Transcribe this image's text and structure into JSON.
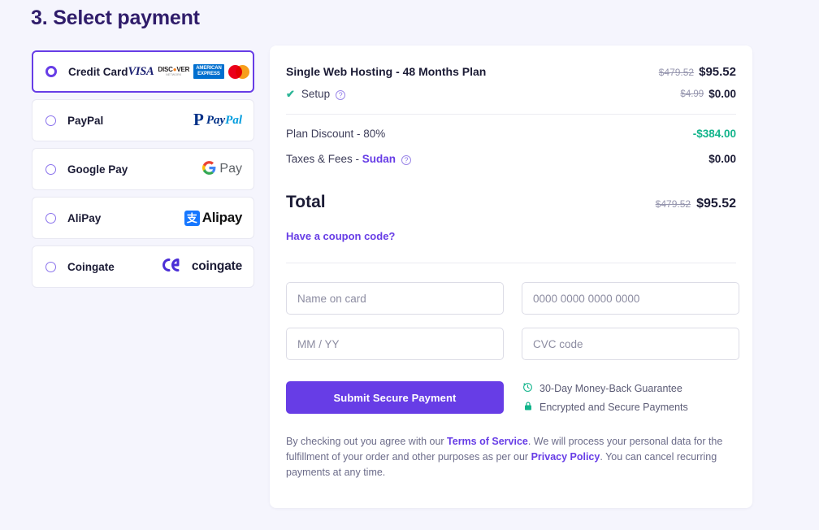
{
  "page": {
    "title": "3. Select payment",
    "background_color": "#f5f5fd",
    "accent_color": "#673de6",
    "success_color": "#12b48b"
  },
  "payment_methods": [
    {
      "id": "credit-card",
      "label": "Credit Card",
      "selected": true,
      "logos": [
        "VISA",
        "DISCOVER",
        "AMERICAN EXPRESS",
        "mastercard"
      ],
      "visa_text": "VISA",
      "discover_top": "DISC VER",
      "discover_bottom": "NETWORK",
      "amex_line1": "AMERICAN",
      "amex_line2": "EXPRESS"
    },
    {
      "id": "paypal",
      "label": "PayPal",
      "selected": false,
      "logo_mark": "P",
      "logo_text_a": "Pay",
      "logo_text_b": "Pal"
    },
    {
      "id": "google-pay",
      "label": "Google Pay",
      "selected": false,
      "logo_mark": "G",
      "logo_text": "Pay"
    },
    {
      "id": "alipay",
      "label": "AliPay",
      "selected": false,
      "logo_mark": "支",
      "logo_text": "Alipay"
    },
    {
      "id": "coingate",
      "label": "Coingate",
      "selected": false,
      "logo_text": "coingate"
    }
  ],
  "order": {
    "plan_name": "Single Web Hosting - 48 Months Plan",
    "plan_price_old": "$479.52",
    "plan_price_new": "$95.52",
    "setup_label": "Setup",
    "setup_check": "✔",
    "setup_help": "?",
    "setup_price_old": "$4.99",
    "setup_price_new": "$0.00",
    "discount_label": "Plan Discount - 80%",
    "discount_value": "-$384.00",
    "taxes_label_prefix": "Taxes & Fees - ",
    "taxes_country": "Sudan",
    "taxes_help": "?",
    "taxes_value": "$0.00",
    "total_label": "Total",
    "total_old": "$479.52",
    "total_new": "$95.52",
    "coupon_link": "Have a coupon code?"
  },
  "form": {
    "name_on_card_placeholder": "Name on card",
    "name_on_card_value": "",
    "card_number_placeholder": "0000 0000 0000 0000",
    "card_number_value": "",
    "expiry_placeholder": "MM / YY",
    "expiry_value": "",
    "cvc_placeholder": "CVC code",
    "cvc_value": "",
    "submit_label": "Submit Secure Payment"
  },
  "assurances": [
    {
      "icon": "clock-icon",
      "glyph": "↻",
      "text": "30-Day Money-Back Guarantee"
    },
    {
      "icon": "lock-icon",
      "glyph": "🔒",
      "text": "Encrypted and Secure Payments"
    }
  ],
  "legal": {
    "part1": "By checking out you agree with our ",
    "terms_link": "Terms of Service",
    "part2": ". We will process your personal data for the fulfillment of your order and other purposes as per our ",
    "privacy_link": "Privacy Policy",
    "part3": ". You can cancel recurring payments at any time."
  }
}
